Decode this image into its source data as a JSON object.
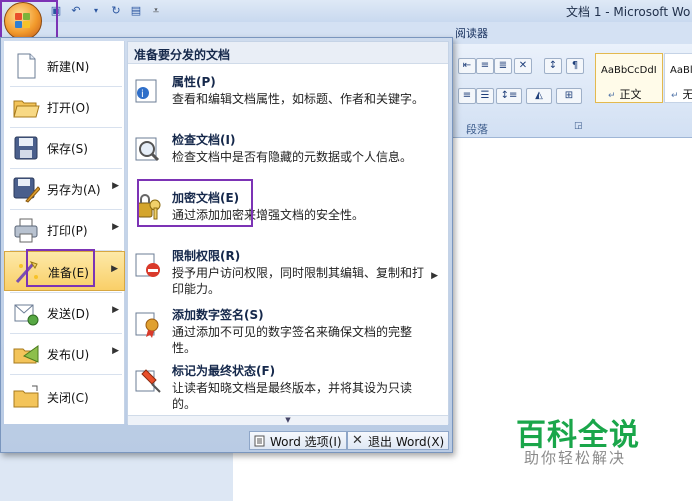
{
  "window": {
    "title": "文档 1 - Microsoft Wo"
  },
  "ribbon": {
    "tab_visible": "阅读器",
    "paragraph_group": "段落",
    "styles": [
      {
        "sample": "AaBbCcDdI",
        "name": "正文"
      },
      {
        "sample": "AaBl",
        "name": "无"
      }
    ]
  },
  "office_menu": {
    "commands": [
      {
        "label": "新建(N)",
        "has_submenu": false,
        "icon": "new-document-icon"
      },
      {
        "label": "打开(O)",
        "has_submenu": false,
        "icon": "open-folder-icon"
      },
      {
        "label": "保存(S)",
        "has_submenu": false,
        "icon": "save-disk-icon"
      },
      {
        "label": "另存为(A)",
        "has_submenu": true,
        "icon": "save-as-icon"
      },
      {
        "label": "打印(P)",
        "has_submenu": true,
        "icon": "printer-icon"
      },
      {
        "label": "准备(E)",
        "has_submenu": true,
        "icon": "prepare-icon",
        "active": true
      },
      {
        "label": "发送(D)",
        "has_submenu": true,
        "icon": "send-icon"
      },
      {
        "label": "发布(U)",
        "has_submenu": true,
        "icon": "publish-icon"
      },
      {
        "label": "关闭(C)",
        "has_submenu": false,
        "icon": "close-folder-icon"
      }
    ],
    "submenu": {
      "title": "准备要分发的文档",
      "items": [
        {
          "title": "属性(P)",
          "desc": "查看和编辑文档属性，如标题、作者和关键字。",
          "icon": "properties-icon"
        },
        {
          "title": "检查文档(I)",
          "desc": "检查文档中是否有隐藏的元数据或个人信息。",
          "icon": "inspect-icon"
        },
        {
          "title": "加密文档(E)",
          "desc": "通过添加加密来增强文档的安全性。",
          "icon": "encrypt-key-icon"
        },
        {
          "title": "限制权限(R)",
          "desc": "授予用户访问权限，同时限制其编辑、复制和打印能力。",
          "icon": "restrict-icon",
          "has_submenu": true
        },
        {
          "title": "添加数字签名(S)",
          "desc": "通过添加不可见的数字签名来确保文档的完整性。",
          "icon": "signature-icon"
        },
        {
          "title": "标记为最终状态(F)",
          "desc": "让读者知晓文档是最终版本，并将其设为只读的。",
          "icon": "mark-final-icon"
        }
      ]
    },
    "footer": {
      "options_label": "Word 选项(I)",
      "exit_label": "退出 Word(X)"
    }
  },
  "watermark": {
    "title": "百科全说",
    "subtitle": "助你轻松解决"
  },
  "colors": {
    "highlight_box": "#7c33b5",
    "active_item": "#f9cf68",
    "watermark_green": "#1aa64a"
  }
}
